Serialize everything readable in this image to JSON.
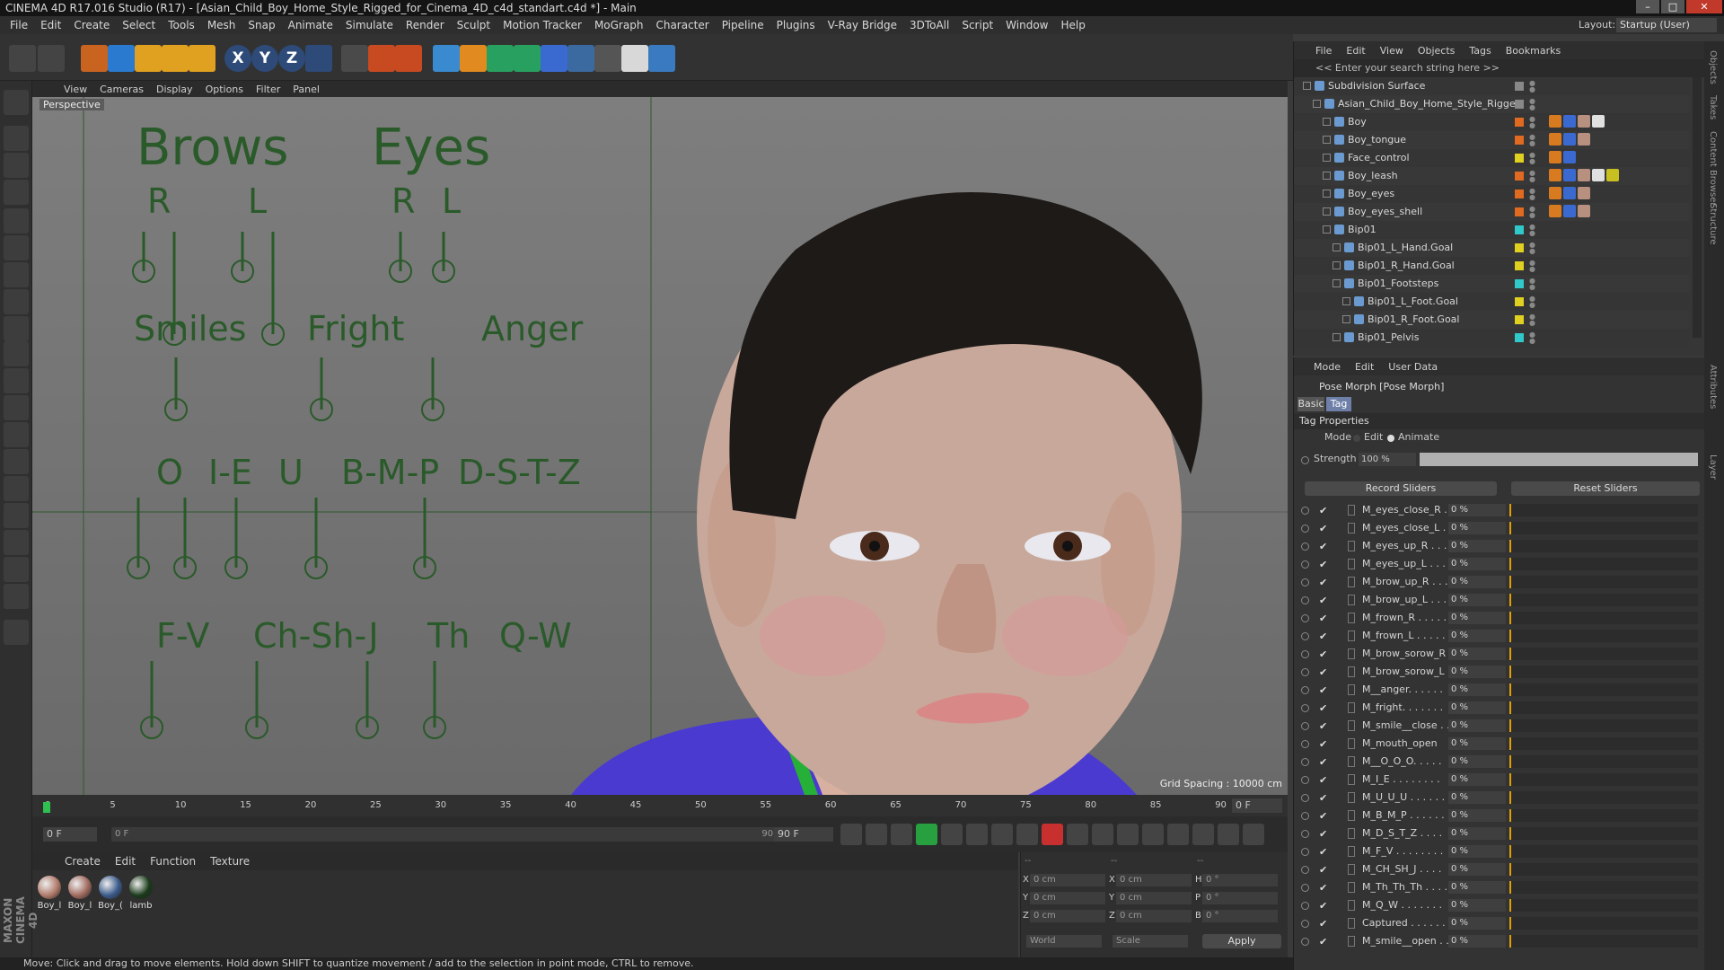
{
  "window": {
    "title": "CINEMA 4D R17.016 Studio (R17) - [Asian_Child_Boy_Home_Style_Rigged_for_Cinema_4D_c4d_standart.c4d *] - Main",
    "controls": [
      "–",
      "□",
      "✕"
    ]
  },
  "menu": [
    "File",
    "Edit",
    "Create",
    "Select",
    "Tools",
    "Mesh",
    "Snap",
    "Animate",
    "Simulate",
    "Render",
    "Sculpt",
    "Motion Tracker",
    "MoGraph",
    "Character",
    "Pipeline",
    "Plugins",
    "V-Ray Bridge",
    "3DToAll",
    "Script",
    "Window",
    "Help"
  ],
  "layout": {
    "label": "Layout:",
    "value": "Startup (User)"
  },
  "toolbar_icons": [
    "undo-icon",
    "redo-icon",
    "live-select-icon",
    "move-icon",
    "scale-icon",
    "rotate-icon",
    "add-icon",
    "x-axis-icon",
    "y-axis-icon",
    "z-axis-icon",
    "world-coord-icon",
    "render-view-icon",
    "render-picture-queue-icon",
    "render-settings-icon",
    "cube-icon",
    "pen-icon",
    "subdivision-icon",
    "array-icon",
    "deformer-icon",
    "floor-icon",
    "camera-icon",
    "light-icon",
    "python-icon"
  ],
  "axis_letters": [
    "X",
    "Y",
    "Z"
  ],
  "viewport": {
    "menu": [
      "View",
      "Cameras",
      "Display",
      "Options",
      "Filter",
      "Panel"
    ],
    "label": "Perspective",
    "grid_spacing": "Grid Spacing : 10000 cm",
    "rig": {
      "brows": "Brows",
      "eyes": "Eyes",
      "r": "R",
      "l": "L",
      "smiles": "Smiles",
      "fright": "Fright",
      "anger": "Anger",
      "visemes_row1": [
        "O",
        "I-E",
        "U",
        "B-M-P",
        "D-S-T-Z"
      ],
      "visemes_row2": [
        "F-V",
        "Ch-Sh-J",
        "Th",
        "Q-W"
      ]
    }
  },
  "timeline": {
    "ticks": [
      "0",
      "5",
      "10",
      "15",
      "20",
      "25",
      "30",
      "35",
      "40",
      "45",
      "50",
      "55",
      "60",
      "65",
      "70",
      "75",
      "80",
      "85",
      "90"
    ],
    "frame_field": "0 F",
    "start": "0 F",
    "range_start": "0 F",
    "range_end": "90 F",
    "end": "90 F"
  },
  "material_panel": {
    "menu": [
      "Create",
      "Edit",
      "Function",
      "Texture"
    ],
    "materials": [
      {
        "label": "Boy_l",
        "color": "#b07a6a"
      },
      {
        "label": "Boy_l",
        "color": "#a06a5e"
      },
      {
        "label": "Boy_(",
        "color": "#3a5a8a"
      },
      {
        "label": "lamb",
        "color": "#1a3a1a"
      }
    ]
  },
  "coords": {
    "header": [
      "--",
      "--",
      "--"
    ],
    "rows": [
      {
        "a": "X",
        "av": "0 cm",
        "b": "X",
        "bv": "0 cm",
        "c": "H",
        "cv": "0 °"
      },
      {
        "a": "Y",
        "av": "0 cm",
        "b": "Y",
        "bv": "0 cm",
        "c": "P",
        "cv": "0 °"
      },
      {
        "a": "Z",
        "av": "0 cm",
        "b": "Z",
        "bv": "0 cm",
        "c": "B",
        "cv": "0 °"
      }
    ],
    "world": "World",
    "scale": "Scale",
    "apply": "Apply"
  },
  "status": "Move: Click and drag to move elements. Hold down SHIFT to quantize movement / add to the selection in point mode, CTRL to remove.",
  "maxon": "MAXON CINEMA 4D",
  "object_manager": {
    "menu": [
      "File",
      "Edit",
      "View",
      "Objects",
      "Tags",
      "Bookmarks"
    ],
    "search": "<< Enter your search string here >>",
    "objects": [
      {
        "name": "Subdivision Surface",
        "indent": 0,
        "color": "#888888",
        "tags": 0
      },
      {
        "name": "Asian_Child_Boy_Home_Style_Rigged",
        "indent": 1,
        "color": "#888888",
        "tags": 0
      },
      {
        "name": "Boy",
        "indent": 2,
        "color": "#e06a20",
        "tags": 4
      },
      {
        "name": "Boy_tongue",
        "indent": 2,
        "color": "#e06a20",
        "tags": 3
      },
      {
        "name": "Face_control",
        "indent": 2,
        "color": "#e0d020",
        "tags": 2
      },
      {
        "name": "Boy_leash",
        "indent": 2,
        "color": "#e06a20",
        "tags": 5
      },
      {
        "name": "Boy_eyes",
        "indent": 2,
        "color": "#e06a20",
        "tags": 3
      },
      {
        "name": "Boy_eyes_shell",
        "indent": 2,
        "color": "#e06a20",
        "tags": 3
      },
      {
        "name": "Bip01",
        "indent": 2,
        "color": "#30c8c8",
        "tags": 0
      },
      {
        "name": "Bip01_L_Hand.Goal",
        "indent": 3,
        "color": "#e0d020",
        "tags": 0
      },
      {
        "name": "Bip01_R_Hand.Goal",
        "indent": 3,
        "color": "#e0d020",
        "tags": 0
      },
      {
        "name": "Bip01_Footsteps",
        "indent": 3,
        "color": "#30c8c8",
        "tags": 0
      },
      {
        "name": "Bip01_L_Foot.Goal",
        "indent": 4,
        "color": "#e0d020",
        "tags": 0
      },
      {
        "name": "Bip01_R_Foot.Goal",
        "indent": 4,
        "color": "#e0d020",
        "tags": 0
      },
      {
        "name": "Bip01_Pelvis",
        "indent": 3,
        "color": "#30c8c8",
        "tags": 0
      }
    ]
  },
  "attributes": {
    "menu": [
      "Mode",
      "Edit",
      "User Data"
    ],
    "title": "Pose Morph [Pose Morph]",
    "tabs": [
      "Basic",
      "Tag"
    ],
    "section": "Tag Properties",
    "mode_label": "Mode",
    "mode_edit": "Edit",
    "mode_animate": "Animate",
    "strength_label": "Strength",
    "strength_value": "100 %",
    "strength_fraction": 1.0,
    "record": "Record Sliders",
    "reset": "Reset Sliders",
    "morphs": [
      {
        "name": "M_eyes_close_R . .",
        "value": "0 %"
      },
      {
        "name": "M_eyes_close_L . .",
        "value": "0 %"
      },
      {
        "name": "M_eyes_up_R . . . .",
        "value": "0 %"
      },
      {
        "name": "M_eyes_up_L . . . .",
        "value": "0 %"
      },
      {
        "name": "M_brow_up_R . . .",
        "value": "0 %"
      },
      {
        "name": "M_brow_up_L . . .",
        "value": "0 %"
      },
      {
        "name": "M_frown_R . . . . .",
        "value": "0 %"
      },
      {
        "name": "M_frown_L . . . . .",
        "value": "0 %"
      },
      {
        "name": "M_brow_sorow_R",
        "value": "0 %"
      },
      {
        "name": "M_brow_sorow_L",
        "value": "0 %"
      },
      {
        "name": "M__anger. . . . . .",
        "value": "0 %"
      },
      {
        "name": "M_fright. . . . . . .",
        "value": "0 %"
      },
      {
        "name": "M_smile__close . .",
        "value": "0 %"
      },
      {
        "name": "M_mouth_open",
        "value": "0 %"
      },
      {
        "name": "M__O_O_O. . . . .",
        "value": "0 %"
      },
      {
        "name": "M_I_E . . . . . . . .",
        "value": "0 %"
      },
      {
        "name": "M_U_U_U . . . . . .",
        "value": "0 %"
      },
      {
        "name": "M_B_M_P . . . . . .",
        "value": "0 %"
      },
      {
        "name": "M_D_S_T_Z . . . .",
        "value": "0 %"
      },
      {
        "name": "M_F_V . . . . . . . .",
        "value": "0 %"
      },
      {
        "name": "M_CH_SH_J . . . .",
        "value": "0 %"
      },
      {
        "name": "M_Th_Th_Th . . . .",
        "value": "0 %"
      },
      {
        "name": "M_Q_W . . . . . . .",
        "value": "0 %"
      },
      {
        "name": "Captured . . . . . .",
        "value": "0 %"
      },
      {
        "name": "M_smile__open . .",
        "value": "0 %"
      }
    ]
  },
  "side_tabs": [
    "Objects",
    "Takes",
    "Content Browser",
    "Structure",
    "Attributes",
    "Layer"
  ]
}
